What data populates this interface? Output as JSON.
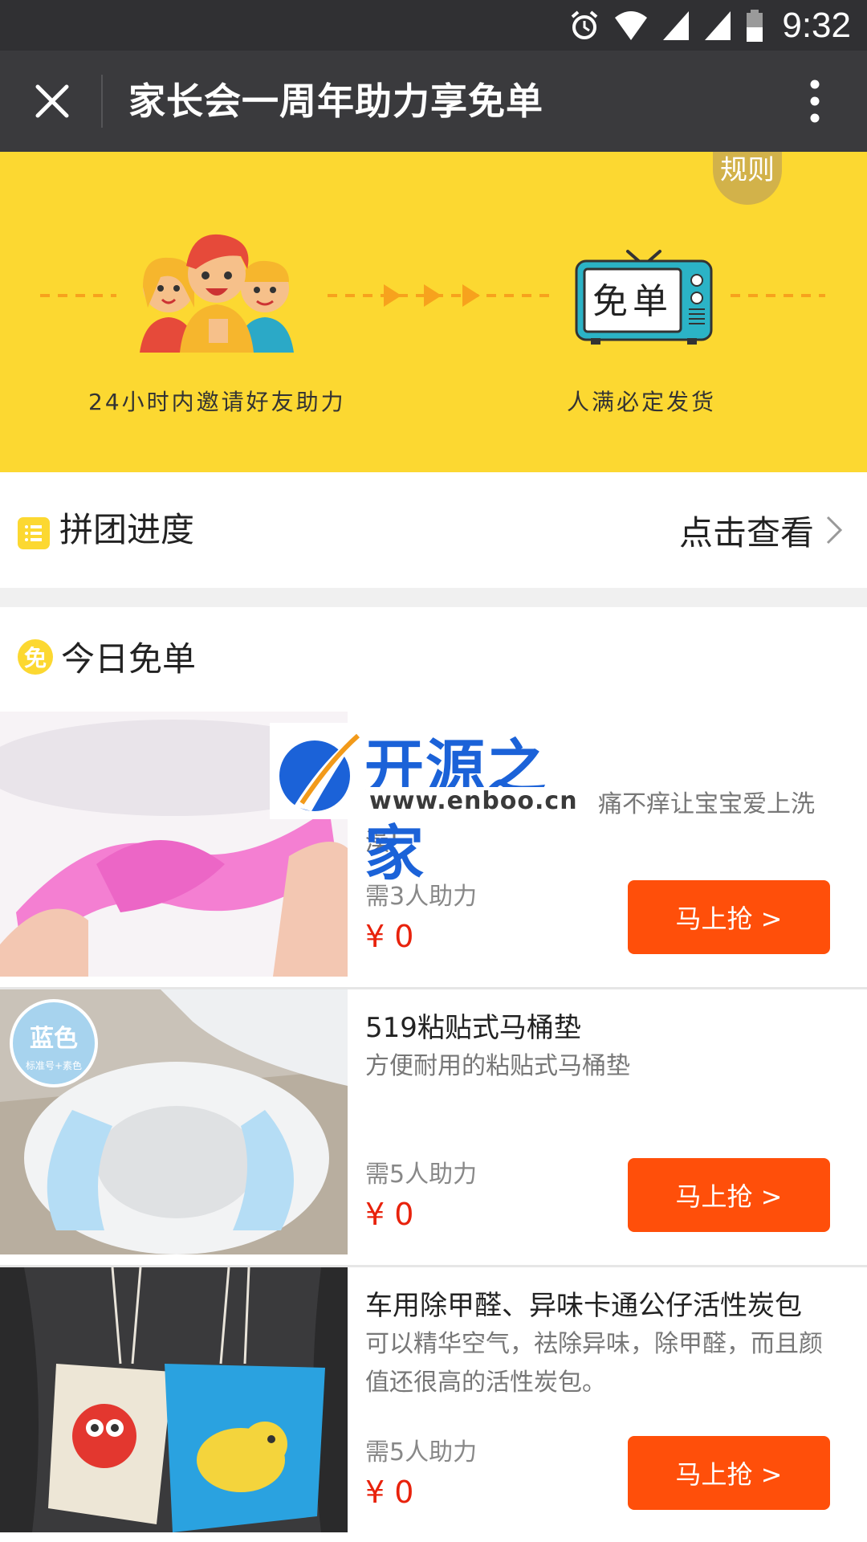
{
  "status_bar": {
    "time": "9:32",
    "icons": [
      "alarm-icon",
      "wifi-icon",
      "signal-icon",
      "signal-icon",
      "battery-icon"
    ]
  },
  "title_bar": {
    "title": "家长会一周年助力享免单",
    "close_icon": "close-icon",
    "more_icon": "more-vertical-icon"
  },
  "banner": {
    "rules_label": "规则",
    "step1_caption": "24小时内邀请好友助力",
    "step2_caption": "人满必定发货",
    "tv_text": "免单",
    "color": "#fcd831"
  },
  "progress": {
    "label": "拼团进度",
    "link": "点击查看",
    "icon": "list-icon"
  },
  "today": {
    "badge": "免",
    "title": "今日免单"
  },
  "watermark": {
    "brand": "开源之家",
    "url": "www.enboo.cn"
  },
  "products": [
    {
      "desc": "痛不痒让宝宝爱上洗澡!",
      "need": "需3人助力",
      "price": "¥ 0",
      "button": "马上抢 >"
    },
    {
      "name": "519粘贴式马桶垫",
      "desc": "方便耐用的粘贴式马桶垫",
      "need": "需5人助力",
      "price": "¥ 0",
      "button": "马上抢 >",
      "image_badge": "蓝色",
      "image_badge_sub": "标准号+素色"
    },
    {
      "name": "车用除甲醛、异味卡通公仔活性炭包",
      "desc": "可以精华空气，祛除异味，除甲醛，而且颜值还很高的活性炭包。",
      "need": "需5人助力",
      "price": "¥ 0",
      "button": "马上抢 >"
    }
  ],
  "colors": {
    "accent": "#ff4f0a",
    "price": "#e8220c",
    "banner_yellow": "#fcd831",
    "status_bar": "#303033",
    "title_bar": "#3a3a3d"
  }
}
